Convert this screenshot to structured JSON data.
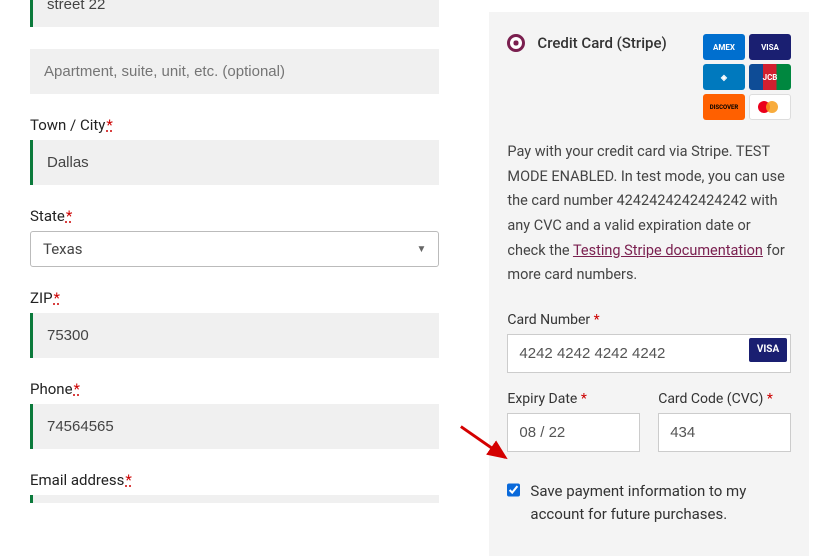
{
  "billing": {
    "street_label_partial": "",
    "street_value": "street 22",
    "apt_placeholder": "Apartment, suite, unit, etc. (optional)",
    "city_label": "Town / City",
    "city_value": "Dallas",
    "state_label": "State",
    "state_value": "Texas",
    "zip_label": "ZIP",
    "zip_value": "75300",
    "phone_label": "Phone",
    "phone_value": "74564565",
    "email_label": "Email address",
    "required_mark": "*"
  },
  "payment": {
    "method_label": "Credit Card (Stripe)",
    "description_pre": "Pay with your credit card via Stripe. TEST MODE ENABLED. In test mode, you can use the card number 4242424242424242 with any CVC and a valid expiration date or check the ",
    "description_link": "Testing Stripe documentation",
    "description_post": " for more card numbers.",
    "card_number_label": "Card Number",
    "card_number_value": "4242 4242 4242 4242",
    "card_number_badge": "VISA",
    "expiry_label": "Expiry Date",
    "expiry_value": "08 / 22",
    "cvc_label": "Card Code (CVC)",
    "cvc_value": "434",
    "save_label": "Save payment information to my account for future purchases.",
    "save_checked": true,
    "logos": {
      "amex": "AMEX",
      "visa": "VISA",
      "diners": "◈",
      "jcb": "JCB",
      "discover": "DISCOVER",
      "mastercard": ""
    }
  }
}
